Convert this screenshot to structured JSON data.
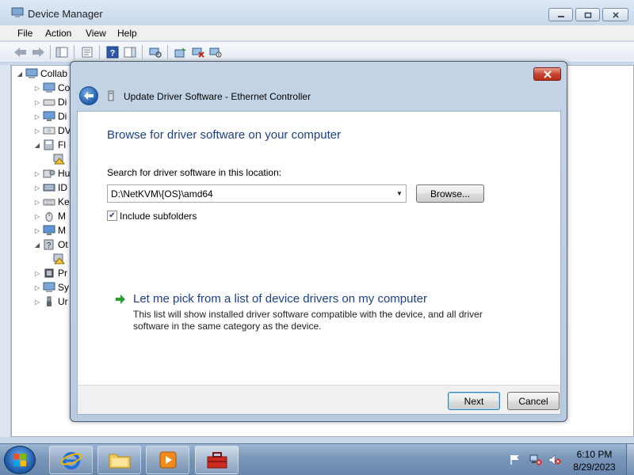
{
  "device_manager": {
    "title": "Device Manager",
    "menu": [
      "File",
      "Action",
      "View",
      "Help"
    ],
    "tree": {
      "root": "Collab",
      "items": [
        "Co",
        "Di",
        "Di",
        "DV",
        "Fl",
        "",
        "Hu",
        "ID",
        "Ke",
        "M",
        "M",
        "Ot",
        "",
        "Pr",
        "Sy",
        "Ur"
      ]
    }
  },
  "dialog": {
    "title": "Update Driver Software - Ethernet Controller",
    "heading": "Browse for driver software on your computer",
    "search_label": "Search for driver software in this location:",
    "path_value": "D:\\NetKVM\\{OS}\\amd64",
    "browse_label": "Browse...",
    "include_subfolders_label": "Include subfolders",
    "include_subfolders_checked": true,
    "pick_title": "Let me pick from a list of device drivers on my computer",
    "pick_description": "This list will show installed driver software compatible with the device, and all driver software in the same category as the device.",
    "next_label": "Next",
    "cancel_label": "Cancel"
  },
  "taskbar": {
    "clock_time": "6:10 PM",
    "clock_date": "8/29/2023"
  },
  "colors": {
    "link_blue": "#1d3f8a",
    "pick_arrow_green": "#2a9d2a",
    "close_red": "#c7402c"
  }
}
